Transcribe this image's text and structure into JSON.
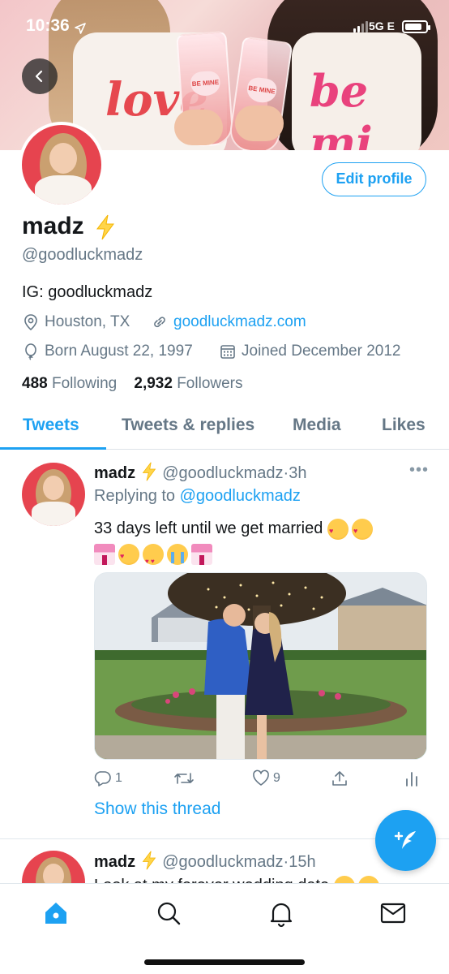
{
  "status_bar": {
    "time": "10:36",
    "network": "5G E"
  },
  "profile": {
    "name": "madz",
    "handle": "@goodluckmadz",
    "bio": "IG: goodluckmadz",
    "location": "Houston, TX",
    "website": "goodluckmadz.com",
    "birthday": "Born August 22, 1997",
    "joined": "Joined December 2012",
    "following_count": "488",
    "following_label": "Following",
    "followers_count": "2,932",
    "followers_label": "Followers",
    "edit_label": "Edit profile"
  },
  "tabs": [
    {
      "label": "Tweets",
      "active": true
    },
    {
      "label": "Tweets & replies",
      "active": false
    },
    {
      "label": "Media",
      "active": false
    },
    {
      "label": "Likes",
      "active": false
    }
  ],
  "tweets": [
    {
      "name": "madz",
      "handle": "@goodluckmadz",
      "time": "3h",
      "reply_prefix": "Replying to",
      "reply_to": "@goodluckmadz",
      "text": "33 days left until we get married",
      "reply_count": "1",
      "retweet_count": "",
      "like_count": "9",
      "show_thread": "Show this thread"
    },
    {
      "name": "madz",
      "handle": "@goodluckmadz",
      "time": "15h",
      "text": "Look at my forever wedding date"
    }
  ],
  "icons": {
    "verified_bolt": "lightning-bolt-icon",
    "location": "location-pin-icon",
    "link": "link-icon",
    "birthday": "balloon-icon",
    "calendar": "calendar-icon"
  },
  "colors": {
    "accent": "#1da1f2",
    "secondary_text": "#657786",
    "primary_text": "#14171a"
  }
}
